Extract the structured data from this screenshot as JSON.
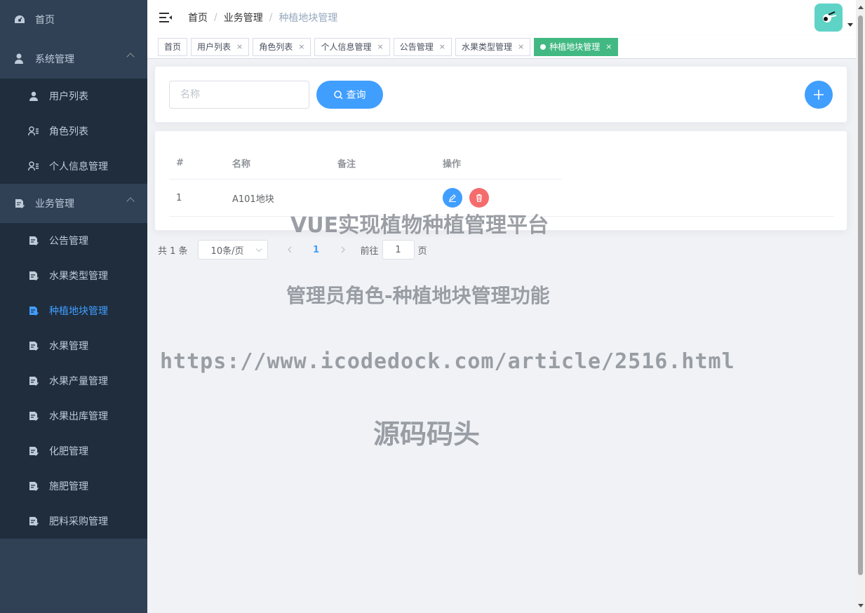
{
  "sidebar": {
    "items": [
      {
        "label": "首页",
        "icon": "dashboard-icon"
      },
      {
        "label": "系统管理",
        "icon": "user-settings-icon",
        "expanded": true,
        "children": [
          {
            "label": "用户列表",
            "icon": "user-icon"
          },
          {
            "label": "角色列表",
            "icon": "role-list-icon"
          },
          {
            "label": "个人信息管理",
            "icon": "role-list-icon"
          }
        ]
      },
      {
        "label": "业务管理",
        "icon": "document-edit-icon",
        "expanded": true,
        "children": [
          {
            "label": "公告管理",
            "icon": "document-edit-icon"
          },
          {
            "label": "水果类型管理",
            "icon": "document-edit-icon"
          },
          {
            "label": "种植地块管理",
            "icon": "document-edit-icon",
            "active": true
          },
          {
            "label": "水果管理",
            "icon": "document-edit-icon"
          },
          {
            "label": "水果产量管理",
            "icon": "document-edit-icon"
          },
          {
            "label": "水果出库管理",
            "icon": "document-edit-icon"
          },
          {
            "label": "化肥管理",
            "icon": "document-edit-icon"
          },
          {
            "label": "施肥管理",
            "icon": "document-edit-icon"
          },
          {
            "label": "肥料采购管理",
            "icon": "document-edit-icon"
          }
        ]
      }
    ]
  },
  "header": {
    "breadcrumb": [
      "首页",
      "业务管理",
      "种植地块管理"
    ]
  },
  "tags": [
    {
      "label": "首页",
      "closable": false
    },
    {
      "label": "用户列表",
      "closable": true
    },
    {
      "label": "角色列表",
      "closable": true
    },
    {
      "label": "个人信息管理",
      "closable": true
    },
    {
      "label": "公告管理",
      "closable": true
    },
    {
      "label": "水果类型管理",
      "closable": true
    },
    {
      "label": "种植地块管理",
      "closable": true,
      "active": true
    }
  ],
  "tag_close_glyph": "×",
  "search": {
    "placeholder": "名称",
    "query_label": "查询"
  },
  "table": {
    "columns": [
      "#",
      "名称",
      "备注",
      "操作"
    ],
    "rows": [
      {
        "index": "1",
        "name": "A101地块",
        "remark": ""
      }
    ]
  },
  "pagination": {
    "total_text": "共 1 条",
    "page_size": "10条/页",
    "current_page": "1",
    "goto_label": "前往",
    "goto_value": "1",
    "page_suffix": "页"
  },
  "watermark": {
    "line1": "VUE实现植物种植管理平台",
    "line2": "管理员角色-种植地块管理功能",
    "line3": "https://www.icodedock.com/article/2516.html",
    "line4": "源码码头"
  },
  "colors": {
    "sidebar_bg": "#304156",
    "submenu_bg": "#1f2d3d",
    "primary": "#409eff",
    "danger": "#f56c6c",
    "active_tag": "#42b983",
    "avatar_bg": "#5ed3c6"
  }
}
